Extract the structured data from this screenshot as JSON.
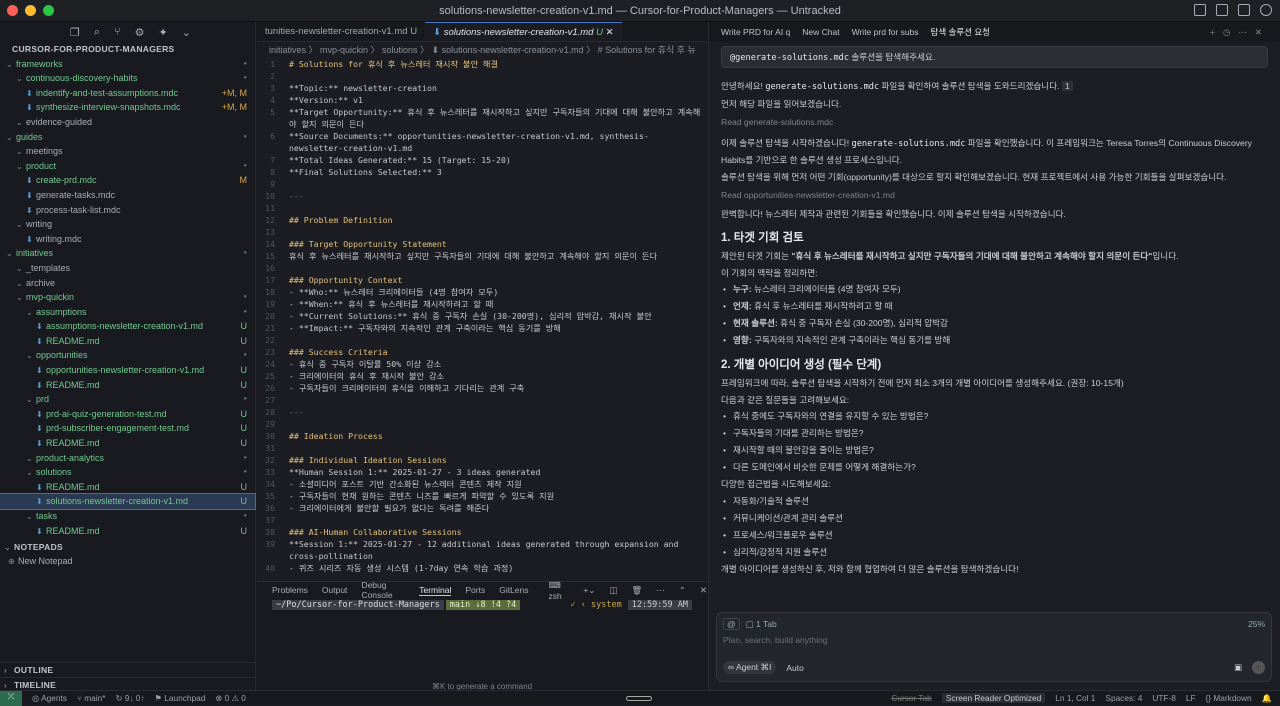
{
  "window": {
    "title": "solutions-newsletter-creation-v1.md — Cursor-for-Product-Managers — Untracked"
  },
  "sidebar": {
    "root": "CURSOR-FOR-PRODUCT-MANAGERS",
    "tree": [
      {
        "label": "frameworks",
        "depth": 0,
        "folder": true,
        "color": "#73c991",
        "status": "dot"
      },
      {
        "label": "continuous-discovery-habits",
        "depth": 1,
        "folder": true,
        "color": "#73c991",
        "status": "dot"
      },
      {
        "label": "indentify-and-test-assumptions.mdc",
        "depth": 2,
        "folder": false,
        "color": "#73c991",
        "status": "+M, M"
      },
      {
        "label": "synthesize-interview-snapshots.mdc",
        "depth": 2,
        "folder": false,
        "color": "#73c991",
        "status": "+M, M"
      },
      {
        "label": "evidence-guided",
        "depth": 1,
        "folder": true,
        "color": "#a9adb5",
        "status": ""
      },
      {
        "label": "guides",
        "depth": 0,
        "folder": true,
        "color": "#73c991",
        "status": "dot"
      },
      {
        "label": "meetings",
        "depth": 1,
        "folder": true,
        "color": "#a9adb5",
        "status": ""
      },
      {
        "label": "product",
        "depth": 1,
        "folder": true,
        "color": "#73c991",
        "status": "dot"
      },
      {
        "label": "create-prd.mdc",
        "depth": 2,
        "folder": false,
        "color": "#73c991",
        "status": "M"
      },
      {
        "label": "generate-tasks.mdc",
        "depth": 2,
        "folder": false,
        "color": "#a9adb5",
        "status": ""
      },
      {
        "label": "process-task-list.mdc",
        "depth": 2,
        "folder": false,
        "color": "#a9adb5",
        "status": ""
      },
      {
        "label": "writing",
        "depth": 1,
        "folder": true,
        "color": "#a9adb5",
        "status": ""
      },
      {
        "label": "writing.mdc",
        "depth": 2,
        "folder": false,
        "color": "#a9adb5",
        "status": ""
      },
      {
        "label": "initiatives",
        "depth": 0,
        "folder": true,
        "color": "#73c991",
        "status": "dot"
      },
      {
        "label": "_templates",
        "depth": 1,
        "folder": true,
        "color": "#a9adb5",
        "status": ""
      },
      {
        "label": "archive",
        "depth": 1,
        "folder": true,
        "color": "#a9adb5",
        "status": ""
      },
      {
        "label": "mvp-quickin",
        "depth": 1,
        "folder": true,
        "color": "#73c991",
        "status": "dot"
      },
      {
        "label": "assumptions",
        "depth": 2,
        "folder": true,
        "color": "#73c991",
        "status": "dot"
      },
      {
        "label": "assumptions-newsletter-creation-v1.md",
        "depth": 3,
        "folder": false,
        "color": "#73c991",
        "status": "U"
      },
      {
        "label": "README.md",
        "depth": 3,
        "folder": false,
        "color": "#73c991",
        "status": "U"
      },
      {
        "label": "opportunities",
        "depth": 2,
        "folder": true,
        "color": "#73c991",
        "status": "dot"
      },
      {
        "label": "opportunities-newsletter-creation-v1.md",
        "depth": 3,
        "folder": false,
        "color": "#73c991",
        "status": "U"
      },
      {
        "label": "README.md",
        "depth": 3,
        "folder": false,
        "color": "#73c991",
        "status": "U"
      },
      {
        "label": "prd",
        "depth": 2,
        "folder": true,
        "color": "#73c991",
        "status": "dot"
      },
      {
        "label": "prd-ai-quiz-generation-test.md",
        "depth": 3,
        "folder": false,
        "color": "#73c991",
        "status": "U"
      },
      {
        "label": "prd-subscriber-engagement-test.md",
        "depth": 3,
        "folder": false,
        "color": "#73c991",
        "status": "U"
      },
      {
        "label": "README.md",
        "depth": 3,
        "folder": false,
        "color": "#73c991",
        "status": "U"
      },
      {
        "label": "product-analytics",
        "depth": 2,
        "folder": true,
        "color": "#73c991",
        "status": "dot"
      },
      {
        "label": "solutions",
        "depth": 2,
        "folder": true,
        "color": "#73c991",
        "status": "dot"
      },
      {
        "label": "README.md",
        "depth": 3,
        "folder": false,
        "color": "#73c991",
        "status": "U"
      },
      {
        "label": "solutions-newsletter-creation-v1.md",
        "depth": 3,
        "folder": false,
        "color": "#73c991",
        "status": "U",
        "selected": true
      },
      {
        "label": "tasks",
        "depth": 2,
        "folder": true,
        "color": "#73c991",
        "status": "dot"
      },
      {
        "label": "README.md",
        "depth": 3,
        "folder": false,
        "color": "#73c991",
        "status": "U"
      }
    ],
    "notepads": "NOTEPADS",
    "new_notepad": "New Notepad",
    "outline": "OUTLINE",
    "timeline": "TIMELINE"
  },
  "editor": {
    "tabs": [
      {
        "label": "tunities-newsletter-creation-v1.md",
        "status": "U"
      },
      {
        "label": "solutions-newsletter-creation-v1.md",
        "status": "U"
      }
    ],
    "breadcrumb": "initiatives 〉 mvp-quickin 〉 solutions 〉 ⬇ solutions-newsletter-creation-v1.md 〉 # Solutions for 휴식 후 뉴",
    "lines": [
      {
        "n": "1",
        "t": "# Solutions for 휴식 후 뉴스레터 재시작 불안 해결",
        "k": "hd"
      },
      {
        "n": "2",
        "t": "",
        "k": ""
      },
      {
        "n": "3",
        "t": "**Topic:** newsletter-creation",
        "k": "b"
      },
      {
        "n": "4",
        "t": "**Version:** v1",
        "k": "b"
      },
      {
        "n": "5",
        "t": "**Target Opportunity:** 휴식 후 뉴스레터를 재시작하고 싶지만 구독자들의 기대에 대해 불안하고 계속해",
        "k": "b"
      },
      {
        "n": "",
        "t": "야 할지 의문이 든다",
        "k": ""
      },
      {
        "n": "6",
        "t": "**Source Documents:** opportunities-newsletter-creation-v1.md, synthesis-",
        "k": "b"
      },
      {
        "n": "",
        "t": "newsletter-creation-v1.md",
        "k": ""
      },
      {
        "n": "7",
        "t": "**Total Ideas Generated:** 15 (Target: 15-20)",
        "k": "b"
      },
      {
        "n": "8",
        "t": "**Final Solutions Selected:** 3",
        "k": "b"
      },
      {
        "n": "9",
        "t": "",
        "k": ""
      },
      {
        "n": "10",
        "t": "---",
        "k": "dim"
      },
      {
        "n": "11",
        "t": "",
        "k": ""
      },
      {
        "n": "12",
        "t": "## Problem Definition",
        "k": "hd"
      },
      {
        "n": "13",
        "t": "",
        "k": ""
      },
      {
        "n": "14",
        "t": "### Target Opportunity Statement",
        "k": "hd"
      },
      {
        "n": "15",
        "t": "휴식 후 뉴스레터를 재시작하고 싶지만 구독자들의 기대에 대해 불안하고 계속해야 할지 의문이 든다",
        "k": ""
      },
      {
        "n": "16",
        "t": "",
        "k": ""
      },
      {
        "n": "17",
        "t": "### Opportunity Context",
        "k": "hd"
      },
      {
        "n": "18",
        "t": "- **Who:** 뉴스레터 크리에이터들 (4명 참여자 모두)",
        "k": "li"
      },
      {
        "n": "19",
        "t": "- **When:** 휴식 후 뉴스레터를 재시작하려고 할 때",
        "k": "li"
      },
      {
        "n": "20",
        "t": "- **Current Solutions:** 휴식 중 구독자 손실 (30-200명), 심리적 압박감, 재시작 불안",
        "k": "li"
      },
      {
        "n": "21",
        "t": "- **Impact:** 구독자와의 지속적인 관계 구축이라는 핵심 동기를 방해",
        "k": "li"
      },
      {
        "n": "22",
        "t": "",
        "k": ""
      },
      {
        "n": "23",
        "t": "### Success Criteria",
        "k": "hd"
      },
      {
        "n": "24",
        "t": "- 휴식 중 구독자 이탈률 50% 이상 감소",
        "k": ""
      },
      {
        "n": "25",
        "t": "- 크리에이터의 휴식 후 재시작 불안 감소",
        "k": ""
      },
      {
        "n": "26",
        "t": "- 구독자들이 크리에이터의 휴식을 이해하고 기다리는 관계 구축",
        "k": ""
      },
      {
        "n": "27",
        "t": "",
        "k": ""
      },
      {
        "n": "28",
        "t": "---",
        "k": "dim"
      },
      {
        "n": "29",
        "t": "",
        "k": ""
      },
      {
        "n": "30",
        "t": "## Ideation Process",
        "k": "hd"
      },
      {
        "n": "31",
        "t": "",
        "k": ""
      },
      {
        "n": "32",
        "t": "### Individual Ideation Sessions",
        "k": "hd"
      },
      {
        "n": "33",
        "t": "**Human Session 1:** 2025-01-27 - 3 ideas generated",
        "k": "li"
      },
      {
        "n": "34",
        "t": "- 소셜미디어 포스트 기반 간소화된 뉴스레터 콘텐츠 제작 지원",
        "k": ""
      },
      {
        "n": "35",
        "t": "- 구독자들이 현재 원하는 콘텐츠 니즈를 빠르게 파악할 수 있도록 지원",
        "k": ""
      },
      {
        "n": "36",
        "t": "- 크리에이터에게 불안할 필요가 없다는 독려를 해준다",
        "k": ""
      },
      {
        "n": "37",
        "t": "",
        "k": ""
      },
      {
        "n": "38",
        "t": "### AI-Human Collaborative Sessions",
        "k": "hd"
      },
      {
        "n": "39",
        "t": "**Session 1:** 2025-01-27 - 12 additional ideas generated through expansion and",
        "k": "li"
      },
      {
        "n": "",
        "t": "cross-pollination",
        "k": ""
      },
      {
        "n": "40",
        "t": "- 퀴즈 시리즈 자동 생성 시스템 (1-7day 연속 학습 과정)",
        "k": ""
      }
    ]
  },
  "panel": {
    "tabs": [
      "Problems",
      "Output",
      "Debug Console",
      "Terminal",
      "Ports",
      "GitLens"
    ],
    "shell": "zsh",
    "path": "~/Po/Cursor-for-Product-Managers",
    "git": "main ↓8 !4 ?4",
    "system": "✓ ‹ system",
    "time": "12:59:59 AM"
  },
  "chat": {
    "tabs": [
      "Write PRD for AI q",
      "New Chat",
      "Write prd for subs",
      "탐색 솔루션 요청"
    ],
    "user_msg_mention": "@generate-solutions.mdc",
    "user_msg_text": " 솔루션을 탐색해주세요.",
    "p1a": "안녕하세요! ",
    "p1code": "generate-solutions.mdc",
    "p1b": " 파일을 확인하여 솔루션 탐색을 도와드리겠습니다.",
    "p1ref": "1",
    "p2": "먼저 해당 파일을 읽어보겠습니다.",
    "read1": "Read generate-solutions.mdc",
    "p3a": "이제 솔루션 탐색을 시작하겠습니다! ",
    "p3code": "generate-solutions.mdc",
    "p3b": " 파일을 확인했습니다. 이 프레임워크는 Teresa Torres의 Continuous Discovery",
    "p3c": "Habits를 기반으로 한 솔루션 생성 프로세스입니다.",
    "p4": "솔루션 탐색을 위해 먼저 어떤 기회(opportunity)를 대상으로 할지 확인해보겠습니다. 현재 프로젝트에서 사용 가능한 기회들을 살펴보겠습니다.",
    "read2": "Read opportunities-newsletter-creation-v1.md",
    "p5": "완벽합니다! 뉴스레터 제작과 관련된 기회들을 확인했습니다. 이제 솔루션 탐색을 시작하겠습니다.",
    "h1": "1. 타겟 기회 검토",
    "p6a": "제안된 타겟 기회는 ",
    "p6b": "\"휴식 후 뉴스레터를 재시작하고 싶지만 구독자들의 기대에 대해 불안하고 계속해야 할지 의문이 든다\"",
    "p6c": "입니다.",
    "p7": "이 기회의 맥락을 정리하면:",
    "ctx": [
      {
        "k": "누구:",
        "v": " 뉴스레터 크리에이터들 (4명 참여자 모두)"
      },
      {
        "k": "언제:",
        "v": " 휴식 후 뉴스레터를 재시작하려고 할 때"
      },
      {
        "k": "현재 솔루션:",
        "v": " 휴식 중 구독자 손실 (30-200명), 심리적 압박감"
      },
      {
        "k": "영향:",
        "v": " 구독자와의 지속적인 관계 구축이라는 핵심 동기를 방해"
      }
    ],
    "h2": "2. 개별 아이디어 생성 (필수 단계)",
    "p8": "프레임워크에 따라, 솔루션 탐색을 시작하기 전에 먼저 최소 3개의 개별 아이디어를 생성해주세요. (권장: 10-15개)",
    "p9": "다음과 같은 질문들을 고려해보세요:",
    "qs": [
      "휴식 중에도 구독자와의 연결을 유지할 수 있는 방법은?",
      "구독자들의 기대를 관리하는 방법은?",
      "재시작할 때의 불안감을 줄이는 방법은?",
      "다른 도메인에서 비슷한 문제를 어떻게 해결하는가?"
    ],
    "p10": "다양한 접근법을 시도해보세요:",
    "approaches": [
      "자동화/기술적 솔루션",
      "커뮤니케이션/관계 관리 솔루션",
      "프로세스/워크플로우 솔루션",
      "심리적/감정적 지원 솔루션"
    ],
    "p11": "개별 아이디어를 생성하신 후, 저와 함께 협업하여 더 많은 솔루션을 탐색하겠습니다!"
  },
  "input": {
    "context": "1 Tab",
    "percent": "25%",
    "placeholder": "Plan, search, build anything",
    "mode": "∞ Agent ⌘I",
    "model": "Auto"
  },
  "hint": "⌘K to generate a command",
  "status": {
    "agents": "Agents",
    "branch": "main*",
    "sync": "↻ 9↓ 0↑",
    "launchpad": "Launchpad",
    "problems": "⊗ 0 ⚠ 0",
    "cursor_tab": "Cursor Tab",
    "screen_reader": "Screen Reader Optimized",
    "position": "Ln 1, Col 1",
    "spaces": "Spaces: 4",
    "encoding": "UTF-8",
    "eol": "LF",
    "lang": "{} Markdown"
  }
}
